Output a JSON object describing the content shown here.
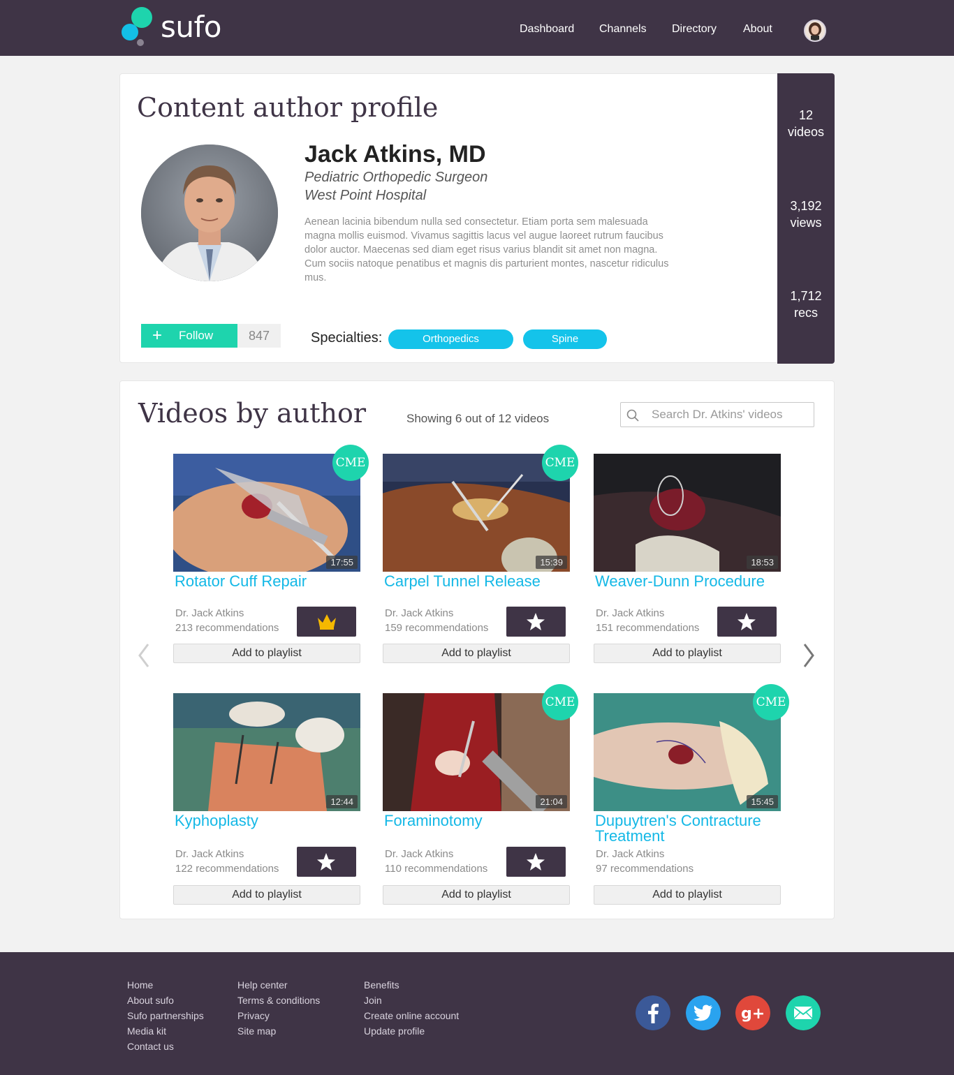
{
  "brand": {
    "name": "sufo"
  },
  "nav": [
    {
      "label": "Dashboard"
    },
    {
      "label": "Channels"
    },
    {
      "label": "Directory"
    },
    {
      "label": "About"
    }
  ],
  "profile": {
    "page_title": "Content author profile",
    "name": "Jack Atkins, MD",
    "role": "Pediatric Orthopedic Surgeon",
    "hospital": "West Point Hospital",
    "bio": "Aenean lacinia bibendum nulla sed consectetur. Etiam porta sem malesuada magna mollis euismod. Vivamus sagittis lacus vel augue laoreet rutrum faucibus dolor auctor. Maecenas sed diam eget risus varius blandit sit amet non magna. Cum sociis natoque penatibus et magnis dis parturient montes, nascetur ridiculus mus.",
    "follow_label": "Follow",
    "follow_count": "847",
    "specialties_label": "Specialties:",
    "specialties": [
      "Orthopedics",
      "Spine"
    ],
    "stats": [
      {
        "value": "12",
        "unit": "videos"
      },
      {
        "value": "3,192",
        "unit": "views"
      },
      {
        "value": "1,712",
        "unit": "recs"
      }
    ]
  },
  "videos": {
    "section_title": "Videos by author",
    "showing": "Showing 6 out of 12 videos",
    "search_placeholder": "Search Dr. Atkins' videos",
    "cme_label": "CME",
    "playlist_label": "Add to playlist",
    "items": [
      {
        "title": "Rotator Cuff Repair",
        "duration": "17:55",
        "author": "Dr. Jack Atkins",
        "recs": "213 recommendations",
        "cme": true,
        "badge": "crown-icon"
      },
      {
        "title": "Carpel Tunnel Release",
        "duration": "15:39",
        "author": "Dr. Jack Atkins",
        "recs": "159 recommendations",
        "cme": true,
        "badge": "star-icon"
      },
      {
        "title": "Weaver-Dunn Procedure",
        "duration": "18:53",
        "author": "Dr. Jack Atkins",
        "recs": "151 recommendations",
        "cme": false,
        "badge": "star-icon"
      },
      {
        "title": "Kyphoplasty",
        "duration": "12:44",
        "author": "Dr. Jack Atkins",
        "recs": "122 recommendations",
        "cme": false,
        "badge": "star-icon"
      },
      {
        "title": "Foraminotomy",
        "duration": "21:04",
        "author": "Dr. Jack Atkins",
        "recs": "110 recommendations",
        "cme": true,
        "badge": "star-icon"
      },
      {
        "title": "Dupuytren's Contracture Treatment",
        "duration": "15:45",
        "author": "Dr. Jack Atkins",
        "recs": "97 recommendations",
        "cme": true,
        "badge": "none"
      }
    ]
  },
  "footer": {
    "col1": [
      "Home",
      "About sufo",
      "Sufo partnerships",
      "Media kit",
      "Contact us"
    ],
    "col2": [
      "Help center",
      "Terms & conditions",
      "Privacy",
      "Site map"
    ],
    "col3": [
      "Benefits",
      "Join",
      "Create online account",
      "Update profile"
    ],
    "social": [
      "facebook-icon",
      "twitter-icon",
      "google-plus-icon",
      "email-icon"
    ]
  },
  "colors": {
    "header": "#3f3446",
    "accent_green": "#1ed4ad",
    "accent_blue": "#14c3ea",
    "link": "#14b8e6"
  }
}
